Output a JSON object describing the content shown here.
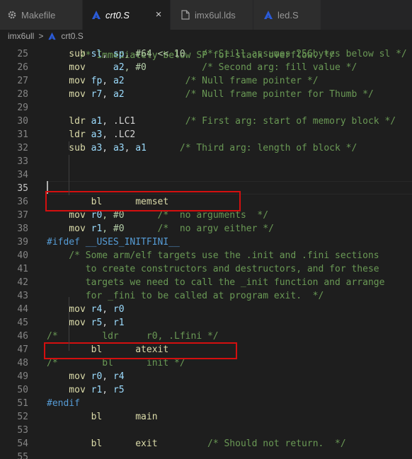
{
  "tabs": [
    {
      "label": "Makefile",
      "icon": "gear-icon",
      "active": false
    },
    {
      "label": "crt0.S",
      "icon": "assembly-file-icon",
      "active": true,
      "close": "×"
    },
    {
      "label": "imx6ul.lds",
      "icon": "file-icon",
      "active": false
    },
    {
      "label": "led.S",
      "icon": "assembly-file-icon",
      "active": false
    }
  ],
  "breadcrumb": {
    "folder": "imx6ull",
    "separator": ">",
    "file": "crt0.S"
  },
  "colors": {
    "background": "#1e1e1e",
    "tab_bar": "#252526",
    "comment": "#6a9955",
    "instruction": "#dcdcaa",
    "register": "#9cdcfe",
    "number": "#b5cea8",
    "preprocessor": "#569cd6",
    "line_number": "#858585",
    "annotation_box": "#d40f0f",
    "asm_icon": "#2b5bd8"
  },
  "editor": {
    "top_partial": "/* Immediately below SP for stack overflow. */",
    "lines": [
      {
        "num": "25",
        "tokens": [
          [
            "    sub ",
            "kw"
          ],
          [
            "sl",
            "reg"
          ],
          [
            ", ",
            "txt"
          ],
          [
            "sp",
            "reg"
          ],
          [
            ", #64 << 10",
            "num"
          ],
          [
            "   /* Still assumes 256bytes below sl */",
            "cm"
          ]
        ]
      },
      {
        "num": "26",
        "tokens": [
          [
            "    mov     ",
            "kw"
          ],
          [
            "a2",
            "reg"
          ],
          [
            ", #0",
            "num"
          ],
          [
            "          /* Second arg: fill value */",
            "cm"
          ]
        ]
      },
      {
        "num": "27",
        "tokens": [
          [
            "    mov ",
            "kw"
          ],
          [
            "fp",
            "reg"
          ],
          [
            ", ",
            "txt"
          ],
          [
            "a2",
            "reg"
          ],
          [
            "           /* Null frame pointer */",
            "cm"
          ]
        ]
      },
      {
        "num": "28",
        "tokens": [
          [
            "    mov ",
            "kw"
          ],
          [
            "r7",
            "reg"
          ],
          [
            ", ",
            "txt"
          ],
          [
            "a2",
            "reg"
          ],
          [
            "           /* Null frame pointer for Thumb */",
            "cm"
          ]
        ]
      },
      {
        "num": "29",
        "tokens": []
      },
      {
        "num": "30",
        "tokens": [
          [
            "    ldr ",
            "kw"
          ],
          [
            "a1",
            "reg"
          ],
          [
            ", .LC1",
            "txt"
          ],
          [
            "         /* First arg: start of memory block */",
            "cm"
          ]
        ]
      },
      {
        "num": "31",
        "tokens": [
          [
            "    ldr ",
            "kw"
          ],
          [
            "a3",
            "reg"
          ],
          [
            ", .LC2",
            "txt"
          ]
        ]
      },
      {
        "num": "32",
        "tokens": [
          [
            "    sub ",
            "kw"
          ],
          [
            "a3",
            "reg"
          ],
          [
            ", ",
            "txt"
          ],
          [
            "a3",
            "reg"
          ],
          [
            ", ",
            "txt"
          ],
          [
            "a1",
            "reg"
          ],
          [
            "      /* Third arg: length of block */",
            "cm"
          ]
        ]
      },
      {
        "num": "33",
        "tokens": []
      },
      {
        "num": "34",
        "tokens": []
      },
      {
        "num": "35",
        "tokens": []
      },
      {
        "num": "36",
        "tokens": [
          [
            "        bl      ",
            "kw"
          ],
          [
            "memset",
            "fn"
          ]
        ]
      },
      {
        "num": "37",
        "tokens": [
          [
            "    mov ",
            "kw"
          ],
          [
            "r0",
            "reg"
          ],
          [
            ", #0",
            "num"
          ],
          [
            "      /*  no arguments  */",
            "cm"
          ]
        ]
      },
      {
        "num": "38",
        "tokens": [
          [
            "    mov ",
            "kw"
          ],
          [
            "r1",
            "reg"
          ],
          [
            ", #0",
            "num"
          ],
          [
            "      /*  no argv either */",
            "cm"
          ]
        ]
      },
      {
        "num": "39",
        "tokens": [
          [
            "#ifdef __USES_INITFINI__",
            "pp"
          ]
        ]
      },
      {
        "num": "40",
        "tokens": [
          [
            "    /* Some arm/elf targets use the .init and .fini sections",
            "cm"
          ]
        ]
      },
      {
        "num": "41",
        "tokens": [
          [
            "       to create constructors and destructors, and for these",
            "cm"
          ]
        ]
      },
      {
        "num": "42",
        "tokens": [
          [
            "       targets we need to call the _init function and arrange",
            "cm"
          ]
        ]
      },
      {
        "num": "43",
        "tokens": [
          [
            "       for _fini to be called at program exit.  */",
            "cm"
          ]
        ]
      },
      {
        "num": "44",
        "tokens": [
          [
            "    mov ",
            "kw"
          ],
          [
            "r4",
            "reg"
          ],
          [
            ", ",
            "txt"
          ],
          [
            "r0",
            "reg"
          ]
        ]
      },
      {
        "num": "45",
        "tokens": [
          [
            "    mov ",
            "kw"
          ],
          [
            "r5",
            "reg"
          ],
          [
            ", ",
            "txt"
          ],
          [
            "r1",
            "reg"
          ]
        ]
      },
      {
        "num": "46",
        "tokens": [
          [
            "/*        ldr     r0, .Lfini */",
            "cm"
          ]
        ]
      },
      {
        "num": "47",
        "tokens": [
          [
            "        bl      ",
            "kw"
          ],
          [
            "atexit",
            "fn"
          ]
        ]
      },
      {
        "num": "48",
        "tokens": [
          [
            "/*        bl      init */",
            "cm"
          ]
        ]
      },
      {
        "num": "49",
        "tokens": [
          [
            "    mov ",
            "kw"
          ],
          [
            "r0",
            "reg"
          ],
          [
            ", ",
            "txt"
          ],
          [
            "r4",
            "reg"
          ]
        ]
      },
      {
        "num": "50",
        "tokens": [
          [
            "    mov ",
            "kw"
          ],
          [
            "r1",
            "reg"
          ],
          [
            ", ",
            "txt"
          ],
          [
            "r5",
            "reg"
          ]
        ]
      },
      {
        "num": "51",
        "tokens": [
          [
            "#endif",
            "pp"
          ]
        ]
      },
      {
        "num": "52",
        "tokens": [
          [
            "        bl      ",
            "kw"
          ],
          [
            "main",
            "fn"
          ]
        ]
      },
      {
        "num": "53",
        "tokens": []
      },
      {
        "num": "54",
        "tokens": [
          [
            "        bl      ",
            "kw"
          ],
          [
            "exit",
            "fn"
          ],
          [
            "         /* Should not return.  */",
            "cm"
          ]
        ]
      },
      {
        "num": "55",
        "tokens": []
      }
    ]
  }
}
